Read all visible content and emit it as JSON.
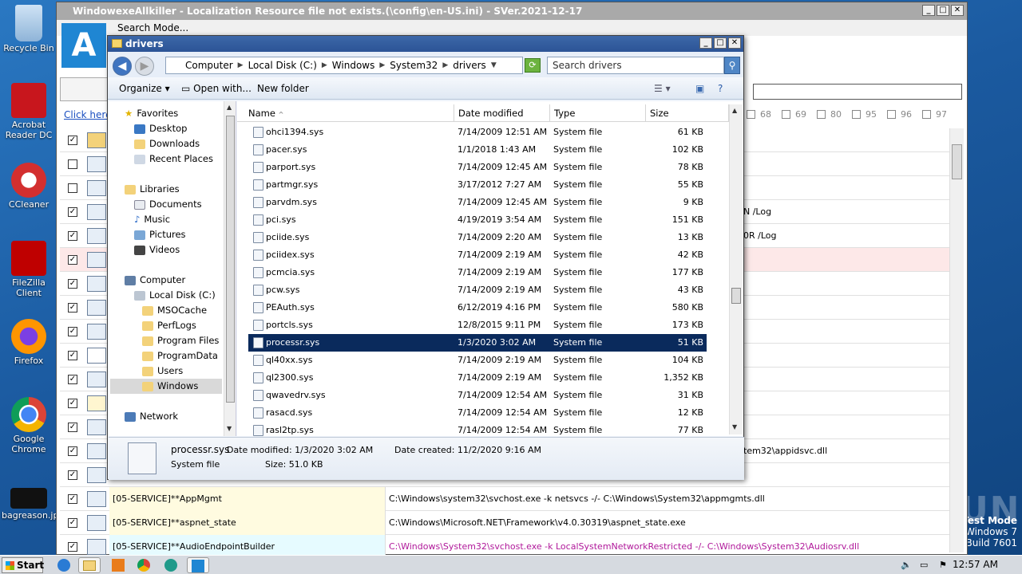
{
  "desktop": {
    "icons": [
      {
        "label": "Recycle Bin"
      },
      {
        "label": "Acrobat Reader DC"
      },
      {
        "label": "CCleaner"
      },
      {
        "label": "FileZilla Client"
      },
      {
        "label": "Firefox"
      },
      {
        "label": "Google Chrome"
      },
      {
        "label": "bagreason.jpg"
      }
    ]
  },
  "main_window": {
    "title": "WindowexeAllkiller - Localization Resource file not exists.(\\config\\en-US.ini) - SVer.2021-12-17",
    "menu": "Search Mode...",
    "click_here": "Click here t",
    "numbers": [
      "68",
      "69",
      "80",
      "95",
      "96",
      "97"
    ],
    "side_texts": [
      "N /Log",
      "0R /Log",
      "tem32\\appidsvc.dll"
    ],
    "rows": [
      {
        "name": "[05-SERVICE]**AppMgmt",
        "cmd": "C:\\Windows\\system32\\svchost.exe -k netsvcs -/- C:\\Windows\\System32\\appmgmts.dll",
        "cmd_color": "#000000"
      },
      {
        "name": "[05-SERVICE]**aspnet_state",
        "cmd": "C:\\Windows\\Microsoft.NET\\Framework\\v4.0.30319\\aspnet_state.exe",
        "cmd_color": "#000000"
      },
      {
        "name": "[05-SERVICE]**AudioEndpointBuilder",
        "cmd": "C:\\Windows\\System32\\svchost.exe -k LocalSystemNetworkRestricted -/- C:\\Windows\\System32\\Audiosrv.dll",
        "cmd_color": "#b0189a"
      }
    ]
  },
  "explorer": {
    "title": "drivers",
    "breadcrumb": [
      "Computer",
      "Local Disk (C:)",
      "Windows",
      "System32",
      "drivers"
    ],
    "search_placeholder": "Search drivers",
    "commands": {
      "organize": "Organize",
      "open_with": "Open with...",
      "new_folder": "New folder"
    },
    "nav": {
      "favorites": "Favorites",
      "desktop": "Desktop",
      "downloads": "Downloads",
      "recent": "Recent Places",
      "libraries": "Libraries",
      "documents": "Documents",
      "music": "Music",
      "pictures": "Pictures",
      "videos": "Videos",
      "computer": "Computer",
      "local_disk": "Local Disk (C:)",
      "msocache": "MSOCache",
      "perflogs": "PerfLogs",
      "program_files": "Program Files",
      "programdata": "ProgramData",
      "users": "Users",
      "windows": "Windows",
      "network": "Network"
    },
    "columns": {
      "name": "Name",
      "date": "Date modified",
      "type": "Type",
      "size": "Size"
    },
    "files": [
      {
        "name": "ohci1394.sys",
        "date": "7/14/2009 12:51 AM",
        "type": "System file",
        "size": "61 KB"
      },
      {
        "name": "pacer.sys",
        "date": "1/1/2018 1:43 AM",
        "type": "System file",
        "size": "102 KB"
      },
      {
        "name": "parport.sys",
        "date": "7/14/2009 12:45 AM",
        "type": "System file",
        "size": "78 KB"
      },
      {
        "name": "partmgr.sys",
        "date": "3/17/2012 7:27 AM",
        "type": "System file",
        "size": "55 KB"
      },
      {
        "name": "parvdm.sys",
        "date": "7/14/2009 12:45 AM",
        "type": "System file",
        "size": "9 KB"
      },
      {
        "name": "pci.sys",
        "date": "4/19/2019 3:54 AM",
        "type": "System file",
        "size": "151 KB"
      },
      {
        "name": "pciide.sys",
        "date": "7/14/2009 2:20 AM",
        "type": "System file",
        "size": "13 KB"
      },
      {
        "name": "pciidex.sys",
        "date": "7/14/2009 2:19 AM",
        "type": "System file",
        "size": "42 KB"
      },
      {
        "name": "pcmcia.sys",
        "date": "7/14/2009 2:19 AM",
        "type": "System file",
        "size": "177 KB"
      },
      {
        "name": "pcw.sys",
        "date": "7/14/2009 2:19 AM",
        "type": "System file",
        "size": "43 KB"
      },
      {
        "name": "PEAuth.sys",
        "date": "6/12/2019 4:16 PM",
        "type": "System file",
        "size": "580 KB"
      },
      {
        "name": "portcls.sys",
        "date": "12/8/2015 9:11 PM",
        "type": "System file",
        "size": "173 KB"
      },
      {
        "name": "processr.sys",
        "date": "1/3/2020 3:02 AM",
        "type": "System file",
        "size": "51 KB",
        "selected": true
      },
      {
        "name": "ql40xx.sys",
        "date": "7/14/2009 2:19 AM",
        "type": "System file",
        "size": "104 KB"
      },
      {
        "name": "ql2300.sys",
        "date": "7/14/2009 2:19 AM",
        "type": "System file",
        "size": "1,352 KB"
      },
      {
        "name": "qwavedrv.sys",
        "date": "7/14/2009 12:54 AM",
        "type": "System file",
        "size": "31 KB"
      },
      {
        "name": "rasacd.sys",
        "date": "7/14/2009 12:54 AM",
        "type": "System file",
        "size": "12 KB"
      },
      {
        "name": "rasl2tp.sys",
        "date": "7/14/2009 12:54 AM",
        "type": "System file",
        "size": "77 KB"
      }
    ],
    "details": {
      "name": "processr.sys",
      "modified": "Date modified: 1/3/2020 3:02 AM",
      "created": "Date created: 11/2/2020 9:16 AM",
      "type": "System file",
      "size": "Size: 51.0 KB"
    }
  },
  "taskbar": {
    "start": "Start",
    "clock": "12:57 AM"
  },
  "overlay": {
    "watermark": "ANY RUN",
    "test_mode": "Test Mode",
    "os": "Windows 7",
    "build": "Build 7601"
  }
}
